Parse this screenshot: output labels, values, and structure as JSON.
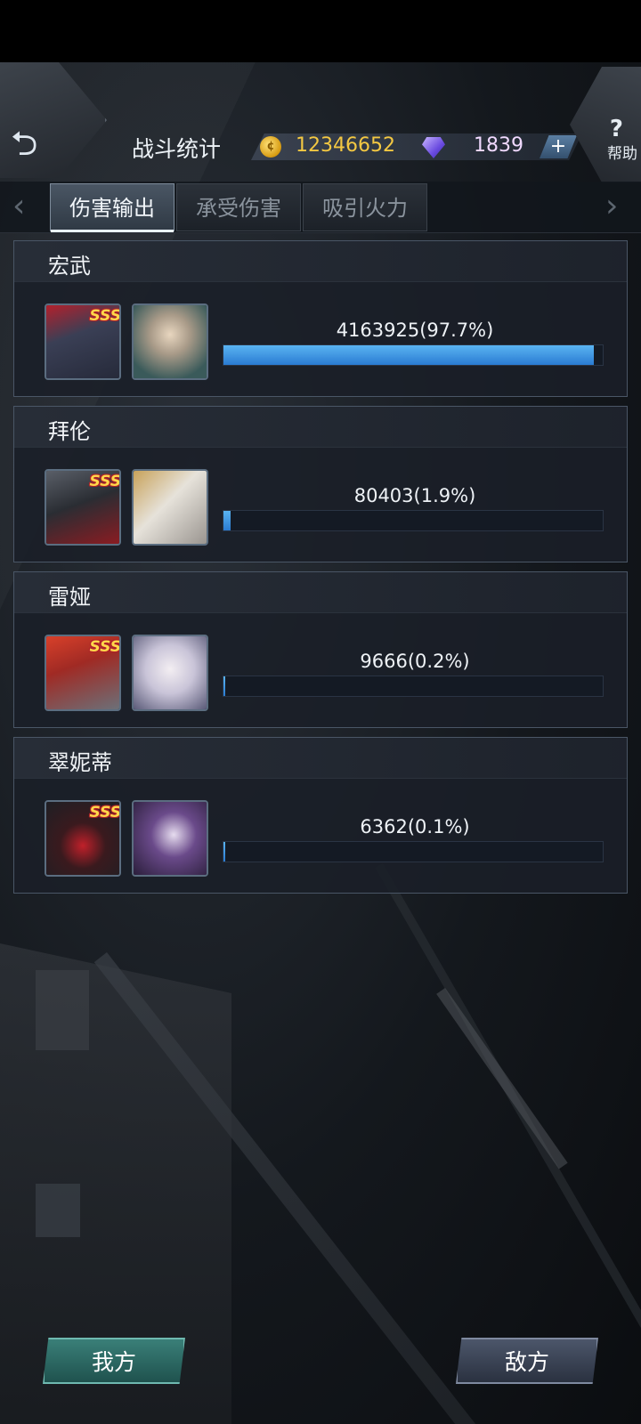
{
  "header": {
    "title": "战斗统计",
    "gold": "12346652",
    "gems": "1839",
    "plus_label": "+",
    "help_icon": "?",
    "help_label": "帮助",
    "back_icon": "⮌"
  },
  "tabs": [
    {
      "label": "伤害输出",
      "active": true
    },
    {
      "label": "承受伤害",
      "active": false
    },
    {
      "label": "吸引火力",
      "active": false
    }
  ],
  "tab_nav": {
    "prev_icon": "‹",
    "next_icon": "›"
  },
  "units": [
    {
      "name": "宏武",
      "rank": "SSS",
      "stat_label": "4163925(97.7%)",
      "share": 0.977
    },
    {
      "name": "拜伦",
      "rank": "SSS",
      "stat_label": "80403(1.9%)",
      "share": 0.019
    },
    {
      "name": "雷娅",
      "rank": "SSS",
      "stat_label": "9666(0.2%)",
      "share": 0.002
    },
    {
      "name": "翠妮蒂",
      "rank": "SSS",
      "stat_label": "6362(0.1%)",
      "share": 0.001
    }
  ],
  "footer": {
    "ours_label": "我方",
    "enemy_label": "敌方"
  },
  "colors": {
    "bar_fill": "#3a8fe0",
    "gold_text": "#f4c842",
    "gem_text": "#f0d9ff",
    "ours_button": "#2d6b64",
    "enemy_button": "#3a4356"
  }
}
